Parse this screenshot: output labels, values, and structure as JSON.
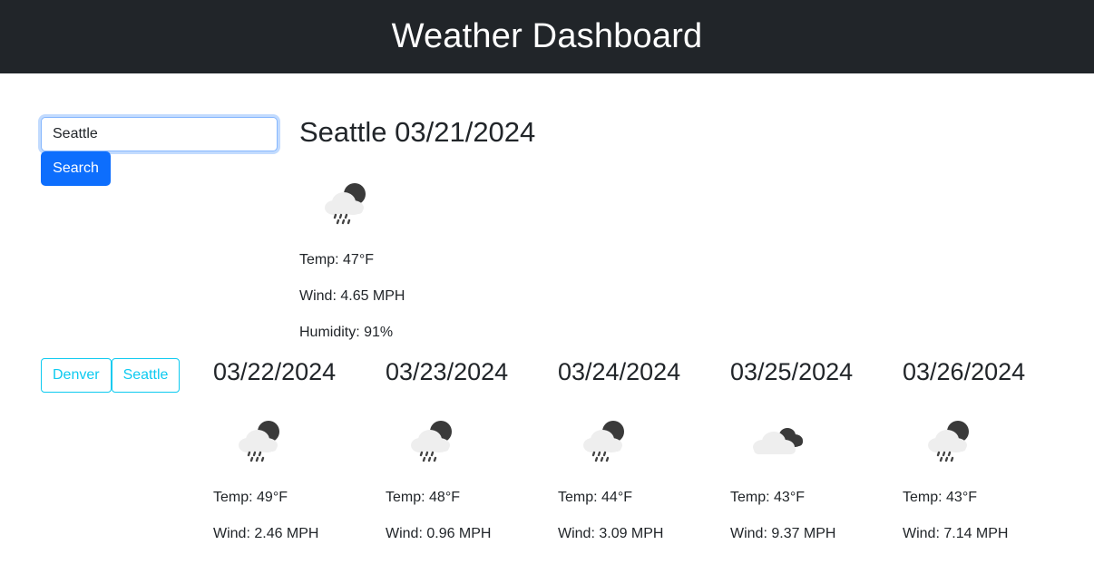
{
  "header": {
    "title": "Weather Dashboard"
  },
  "search": {
    "value": "Seattle",
    "button_label": "Search"
  },
  "history": [
    {
      "label": "Denver"
    },
    {
      "label": "Seattle"
    }
  ],
  "current": {
    "title": "Seattle 03/21/2024",
    "icon": "rain-night-icon",
    "temp": "Temp: 47°F",
    "wind": "Wind: 4.65 MPH",
    "humidity": "Humidity: 91%"
  },
  "forecast": [
    {
      "date": "03/22/2024",
      "icon": "rain-night-icon",
      "temp": "Temp: 49°F",
      "wind": "Wind: 2.46 MPH"
    },
    {
      "date": "03/23/2024",
      "icon": "rain-night-icon",
      "temp": "Temp: 48°F",
      "wind": "Wind: 0.96 MPH"
    },
    {
      "date": "03/24/2024",
      "icon": "rain-night-icon",
      "temp": "Temp: 44°F",
      "wind": "Wind: 3.09 MPH"
    },
    {
      "date": "03/25/2024",
      "icon": "broken-clouds-icon",
      "temp": "Temp: 43°F",
      "wind": "Wind: 9.37 MPH"
    },
    {
      "date": "03/26/2024",
      "icon": "rain-night-icon",
      "temp": "Temp: 43°F",
      "wind": "Wind: 7.14 MPH"
    }
  ],
  "colors": {
    "header_bg": "#212529",
    "primary": "#0d6efd",
    "info": "#0dcaf0"
  }
}
